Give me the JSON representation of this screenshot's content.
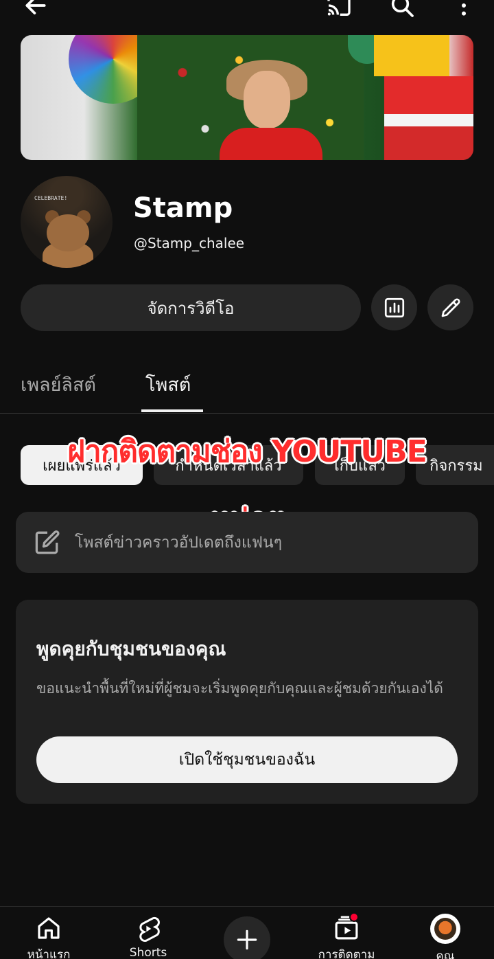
{
  "header": {
    "back_icon": "arrow-left-icon",
    "cast_icon": "cast-icon",
    "search_icon": "search-icon",
    "more_icon": "more-vertical-icon"
  },
  "channel": {
    "name": "Stamp",
    "handle": "@Stamp_chalee",
    "avatar_text": "CELEBRATE!"
  },
  "actions": {
    "manage_videos": "จัดการวิดีโอ",
    "analytics_icon": "analytics-icon",
    "edit_icon": "pencil-icon"
  },
  "tabs": [
    {
      "label": "เพลย์ลิสต์",
      "active": false
    },
    {
      "label": "โพสต์",
      "active": true
    }
  ],
  "chips": [
    {
      "label": "เผยแพร่แล้ว",
      "active": true
    },
    {
      "label": "กำหนดเวลาแล้ว",
      "active": false
    },
    {
      "label": "เก็บแล้ว",
      "active": false
    },
    {
      "label": "กิจกรรม",
      "active": false
    }
  ],
  "overlay": {
    "line1": "ฝากติดตามช่อง YOUTUBE",
    "line2": "หน่อย"
  },
  "composer": {
    "placeholder": "โพสต์ข่าวคราวอัปเดตถึงแฟนๆ"
  },
  "community_card": {
    "title": "พูดคุยกับชุมชนของคุณ",
    "description": "ขอแนะนำพื้นที่ใหม่ที่ผู้ชมจะเริ่มพูดคุยกับคุณและผู้ชมด้วยกันเองได้",
    "button": "เปิดใช้ชุมชนของฉัน"
  },
  "bottom_nav": {
    "home": "หน้าแรก",
    "shorts": "Shorts",
    "subscriptions": "การติดตาม",
    "you": "คุณ"
  },
  "colors": {
    "background": "#0f0f0f",
    "surface": "#272727",
    "text_primary": "#f1f1f1",
    "text_secondary": "#aaaaaa",
    "overlay_red": "#ff2d2d",
    "notification_red": "#ff0033"
  }
}
